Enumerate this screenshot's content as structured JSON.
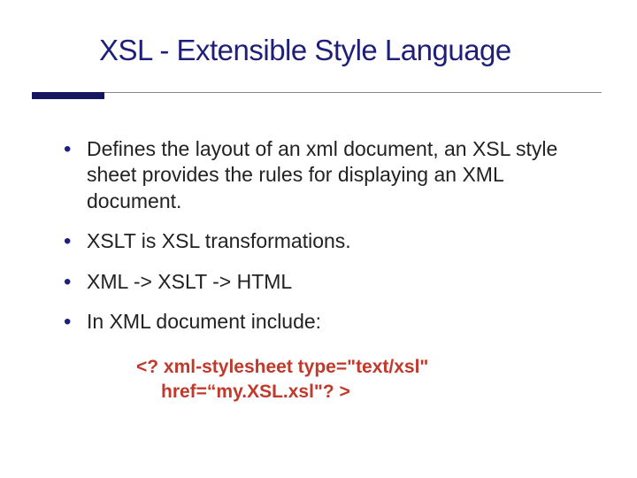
{
  "title": "XSL - Extensible Style Language",
  "bullets": {
    "b1": "Defines the layout of an xml document, an XSL style sheet provides the rules for displaying an XML document.",
    "b2": "XSLT is XSL transformations.",
    "b3": "XML -> XSLT -> HTML",
    "b4": "In XML document include:"
  },
  "code": {
    "l1": "<? xml-stylesheet type=\"text/xsl\"",
    "l2": "href=“my.XSL.xsl\"? >"
  }
}
